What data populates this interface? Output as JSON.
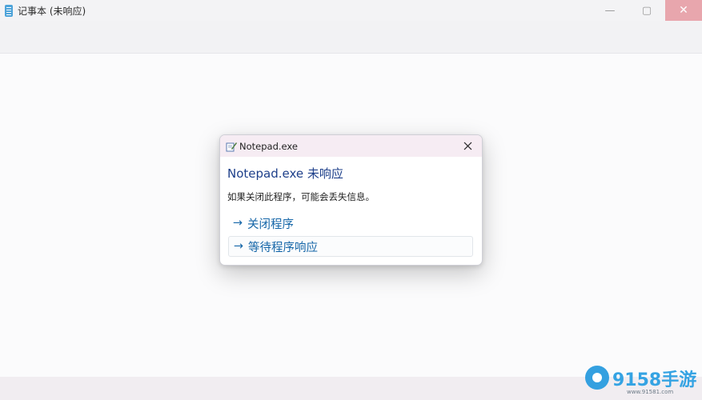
{
  "window": {
    "title": "记事本 (未响应)",
    "minimize_glyph": "—",
    "maximize_glyph": "▢",
    "close_glyph": "✕"
  },
  "dialog": {
    "title": "Notepad.exe",
    "heading": "Notepad.exe 未响应",
    "message": "如果关闭此程序，可能会丢失信息。",
    "options": [
      {
        "arrow": "→",
        "label": "关闭程序"
      },
      {
        "arrow": "→",
        "label": "等待程序响应"
      }
    ],
    "icons": {
      "title_icon": "notepad-app-icon",
      "close_icon": "close-icon"
    }
  },
  "watermark": {
    "brand": "9158手游",
    "url": "www.91581.com"
  },
  "colors": {
    "heading": "#1d3f8a",
    "option_link": "#1566a8",
    "close_button_bg": "#e8a6ad",
    "watermark": "#35a3e3"
  }
}
